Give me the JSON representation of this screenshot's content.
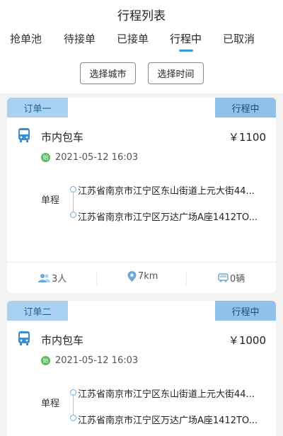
{
  "header": {
    "title": "行程列表"
  },
  "tabs": [
    {
      "label": "抢单池"
    },
    {
      "label": "待接单"
    },
    {
      "label": "已接单"
    },
    {
      "label": "行程中"
    },
    {
      "label": "已取消"
    }
  ],
  "active_tab": "行程中",
  "filters": {
    "city_label": "选择城市",
    "time_label": "选择时间"
  },
  "colors": {
    "accent": "#3b9ad9",
    "tag_bg": "#a8d1f3",
    "start_dot": "#5cb85c"
  },
  "orders": [
    {
      "order_label": "订单一",
      "status": "行程中",
      "service": "市内包车",
      "price": "￥1100",
      "datetime": "2021-05-12 16:03",
      "trip_type": "单程",
      "from": "江苏省南京市江宁区东山街道上元大街44...",
      "to": "江苏省南京市江宁区万达广场A座1412TO...",
      "passengers": "3人",
      "distance": "7km",
      "vehicles": "0辆"
    },
    {
      "order_label": "订单二",
      "status": "行程中",
      "service": "市内包车",
      "price": "￥1000",
      "datetime": "2021-05-12 16:03",
      "trip_type": "单程",
      "from": "江苏省南京市江宁区东山街道上元大街44...",
      "to": "江苏省南京市江宁区万达广场A座1412TO..."
    }
  ]
}
